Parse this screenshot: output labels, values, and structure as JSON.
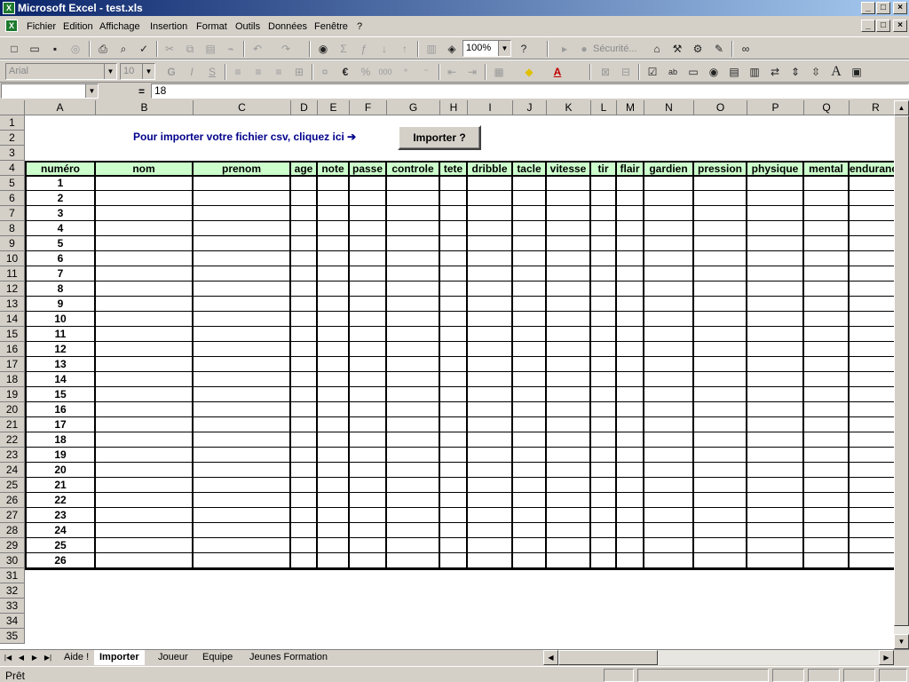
{
  "window": {
    "title": "Microsoft Excel - test.xls",
    "app_icon": "excel-icon",
    "min": "_",
    "max": "□",
    "close": "×"
  },
  "menu": {
    "items": [
      "Fichier",
      "Edition",
      "Affichage",
      "Insertion",
      "Format",
      "Outils",
      "Données",
      "Fenêtre",
      "?"
    ],
    "doc_min": "_",
    "doc_max": "□",
    "doc_close": "×"
  },
  "toolbar1": {
    "zoom": "100%",
    "securite": "Sécurité..."
  },
  "toolbar2": {
    "font": "Arial",
    "size": "10",
    "bold": "G",
    "italic": "I",
    "underline": "S",
    "euro": "€",
    "thousands": "000",
    "text_color_letter": "A",
    "label_letter": "A"
  },
  "formula": {
    "namebox": "",
    "equals": "=",
    "value": "18"
  },
  "columns": [
    "A",
    "B",
    "C",
    "D",
    "E",
    "F",
    "G",
    "H",
    "I",
    "J",
    "K",
    "L",
    "M",
    "N",
    "O",
    "P",
    "Q",
    "R"
  ],
  "rows": [
    "1",
    "2",
    "3",
    "4",
    "5",
    "6",
    "7",
    "8",
    "9",
    "10",
    "11",
    "12",
    "13",
    "14",
    "15",
    "16",
    "17",
    "18",
    "19",
    "20",
    "21",
    "22",
    "23",
    "24",
    "25",
    "26",
    "27",
    "28",
    "29",
    "30",
    "31",
    "32",
    "33",
    "34",
    "35"
  ],
  "sheet": {
    "csv_label": "Pour importer votre fichier csv, cliquez ici ➔",
    "import_button": "Importer ?",
    "headers": [
      "numéro",
      "nom",
      "prenom",
      "age",
      "note",
      "passe",
      "controle",
      "tete",
      "dribble",
      "tacle",
      "vitesse",
      "tir",
      "flair",
      "gardien",
      "pression",
      "physique",
      "mental",
      "endurance"
    ],
    "numbers": [
      "1",
      "2",
      "3",
      "4",
      "5",
      "6",
      "7",
      "8",
      "9",
      "10",
      "11",
      "12",
      "13",
      "14",
      "15",
      "16",
      "17",
      "18",
      "19",
      "20",
      "21",
      "22",
      "23",
      "24",
      "25",
      "26"
    ]
  },
  "tabs": [
    "Aide !",
    "Importer",
    "Joueur",
    "Equipe",
    "Jeunes Formation"
  ],
  "active_tab": "Importer",
  "status": {
    "text": "Prêt"
  },
  "colors": {
    "header_fill": "#ccffcc",
    "label_blue": "#00008b",
    "title_blue": "#0a246a"
  }
}
